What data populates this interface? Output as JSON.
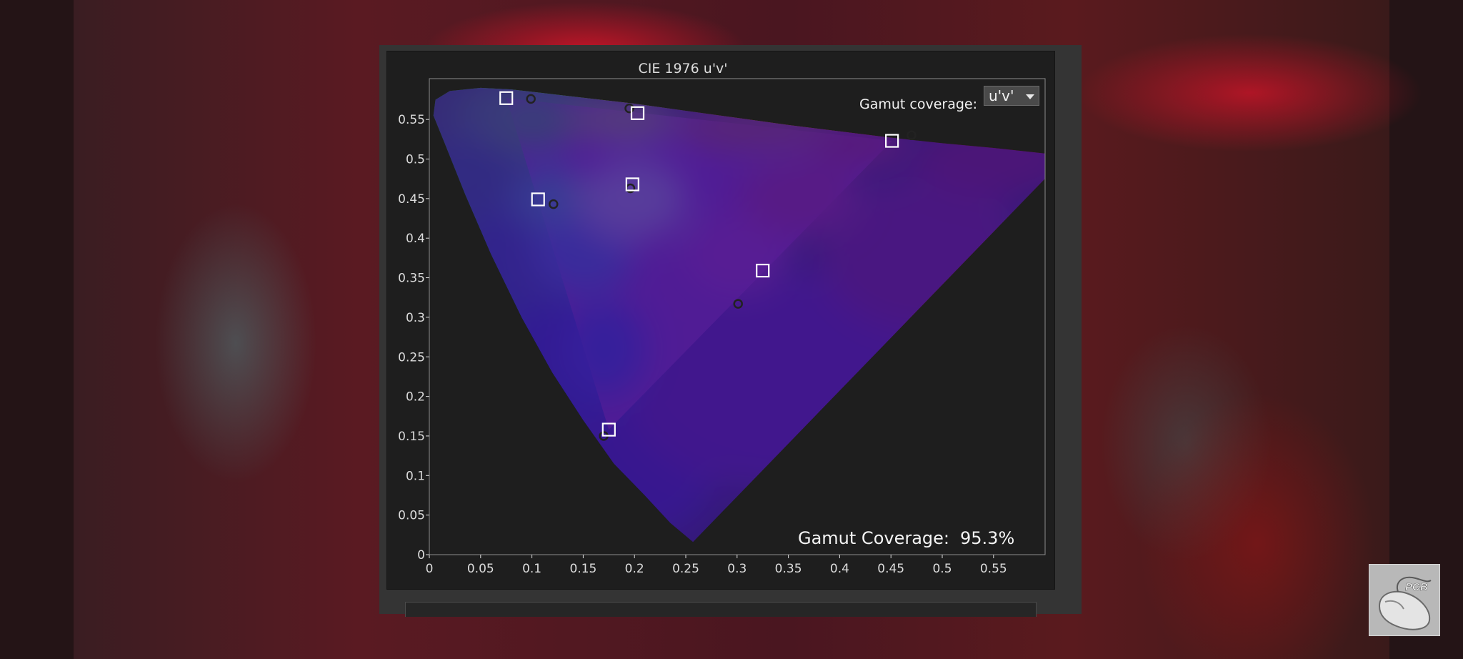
{
  "colors": {
    "panel": "#1e1e1e",
    "frame": "#343434",
    "axis_text": "#dcdcdc",
    "plot_border": "#8c8c8c",
    "target_marker": "#ffffff",
    "accent_red": "#d01428"
  },
  "gamut_control": {
    "label": "Gamut coverage:",
    "selected": "u'v'",
    "arrow_icon": "chevron-down-icon"
  },
  "logo": {
    "text": "PCB",
    "icon": "mouse-icon"
  },
  "chart_data": {
    "type": "scatter",
    "title": "CIE 1976 u'v'",
    "xlabel": "",
    "ylabel": "",
    "xlim": [
      0,
      0.6
    ],
    "ylim": [
      0,
      0.6
    ],
    "x_ticks": [
      "0",
      "0.05",
      "0.1",
      "0.15",
      "0.2",
      "0.25",
      "0.3",
      "0.35",
      "0.4",
      "0.45",
      "0.5",
      "0.55"
    ],
    "y_ticks": [
      "0",
      "0.05",
      "0.1",
      "0.15",
      "0.2",
      "0.25",
      "0.3",
      "0.35",
      "0.4",
      "0.45",
      "0.5",
      "0.55"
    ],
    "grid": false,
    "legend": "none",
    "annotation": {
      "label": "Gamut Coverage:",
      "value": "95.3%"
    },
    "gamut_triangle": {
      "red": [
        0.451,
        0.523
      ],
      "green": [
        0.075,
        0.577
      ],
      "blue": [
        0.175,
        0.158
      ]
    },
    "target_points": [
      {
        "id": "green",
        "u": 0.075,
        "v": 0.577
      },
      {
        "id": "yellow",
        "u": 0.203,
        "v": 0.558
      },
      {
        "id": "red",
        "u": 0.451,
        "v": 0.523
      },
      {
        "id": "white",
        "u": 0.198,
        "v": 0.468
      },
      {
        "id": "cyan",
        "u": 0.106,
        "v": 0.449
      },
      {
        "id": "magenta",
        "u": 0.325,
        "v": 0.359
      },
      {
        "id": "blue",
        "u": 0.175,
        "v": 0.158
      }
    ],
    "measured_points": [
      {
        "id": "green",
        "u": 0.099,
        "v": 0.576
      },
      {
        "id": "yellow",
        "u": 0.195,
        "v": 0.564
      },
      {
        "id": "red",
        "u": 0.47,
        "v": 0.53
      },
      {
        "id": "white",
        "u": 0.196,
        "v": 0.463
      },
      {
        "id": "cyan",
        "u": 0.121,
        "v": 0.443
      },
      {
        "id": "magenta",
        "u": 0.301,
        "v": 0.317
      },
      {
        "id": "blue",
        "u": 0.17,
        "v": 0.15
      }
    ]
  }
}
